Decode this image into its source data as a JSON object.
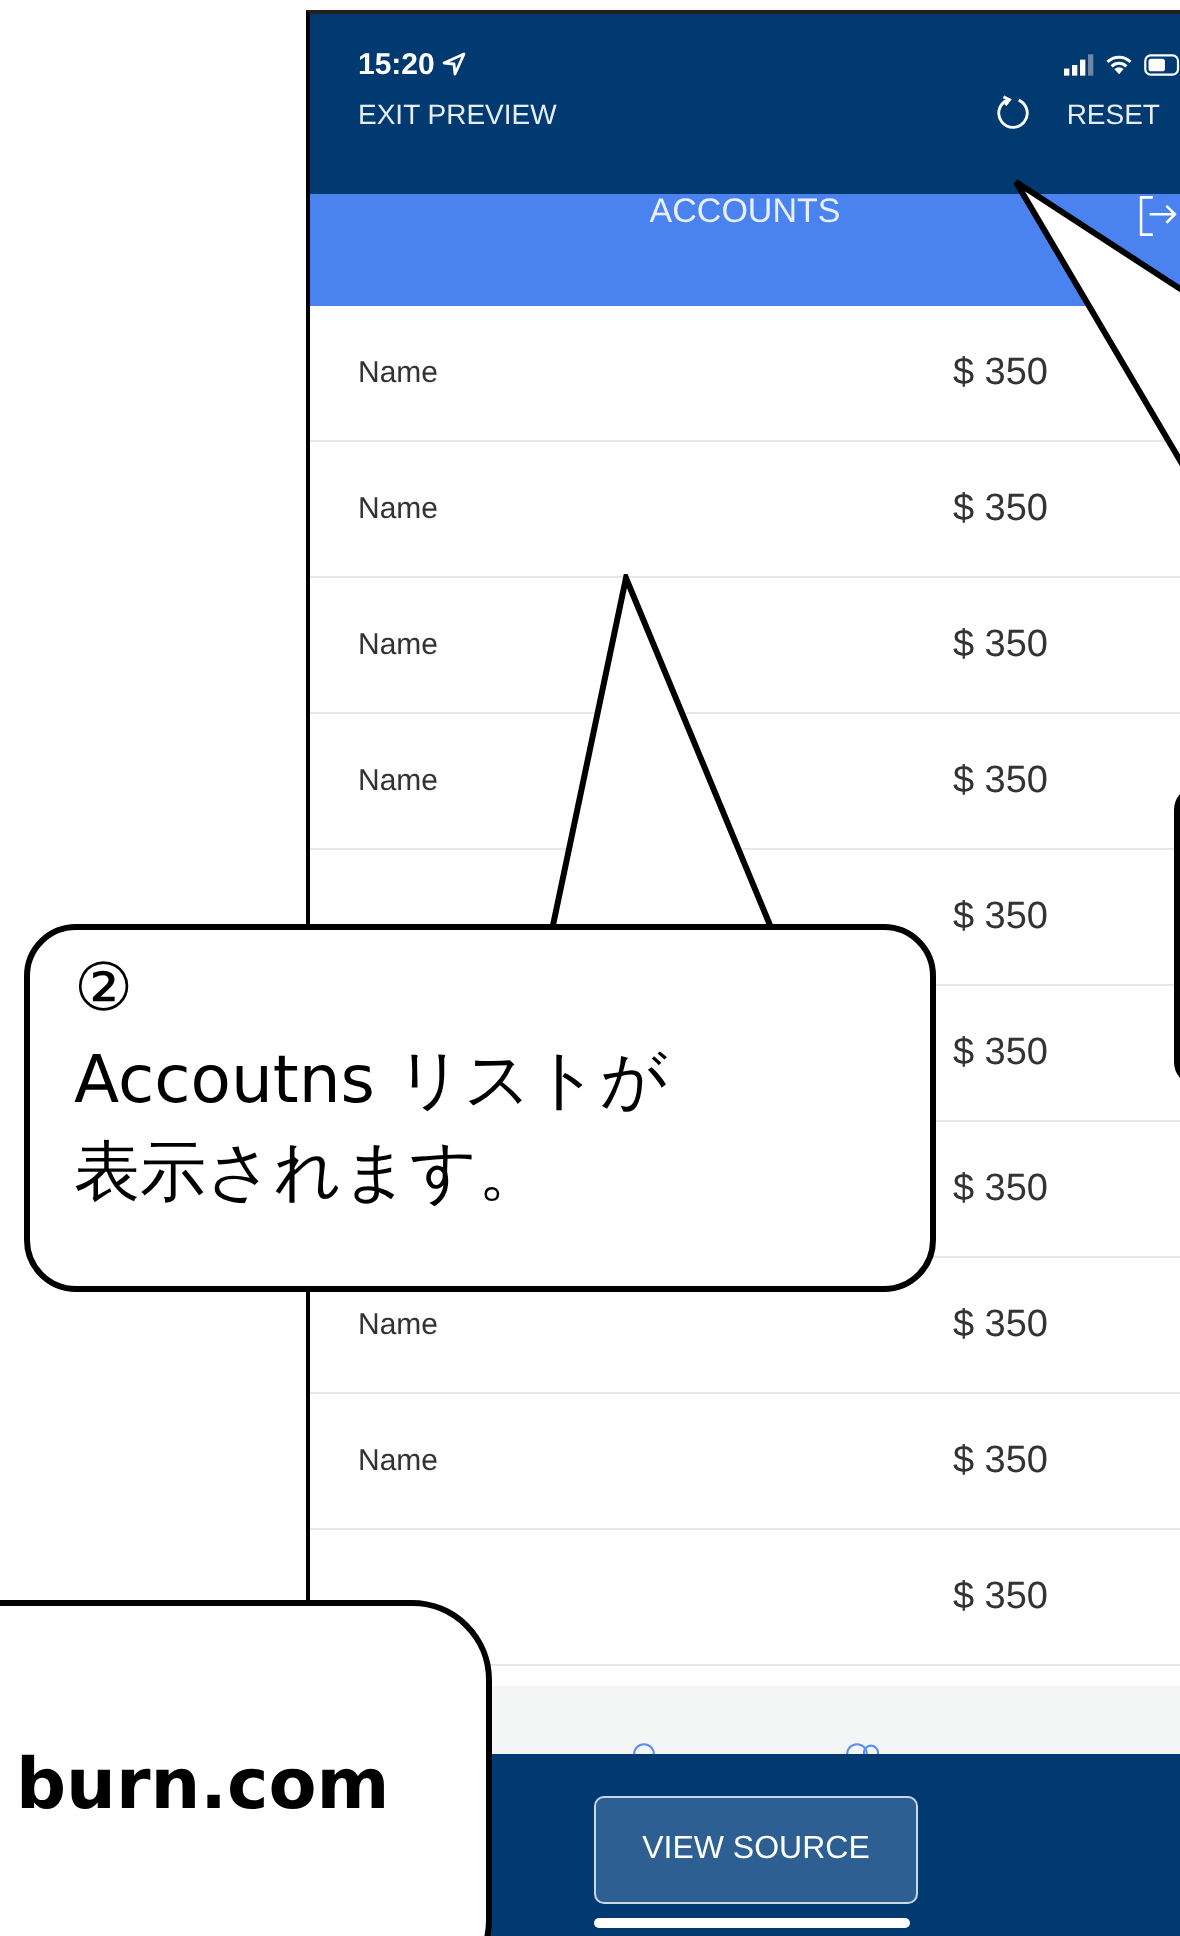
{
  "status_bar": {
    "time": "15:20"
  },
  "preview_bar": {
    "exit": "EXIT PREVIEW",
    "reset": "RESET"
  },
  "nav_bar": {
    "title": "ACCOUNTS"
  },
  "rows": [
    {
      "name": "Name",
      "amount": "$ 350"
    },
    {
      "name": "Name",
      "amount": "$ 350"
    },
    {
      "name": "Name",
      "amount": "$ 350"
    },
    {
      "name": "Name",
      "amount": "$ 350"
    },
    {
      "amount": "$ 350"
    },
    {
      "amount": "$ 350"
    },
    {
      "amount": "$ 350"
    },
    {
      "name": "Name",
      "amount": "$ 350"
    },
    {
      "name": "Name",
      "amount": "$ 350"
    },
    {
      "amount": "$ 350"
    }
  ],
  "bottom_bar": {
    "button": "VIEW SOURCE"
  },
  "callouts": [
    {
      "kind": "list",
      "lines": [
        "②",
        "Accoutns リストが",
        "表示されます。"
      ]
    },
    {
      "kind": "corner",
      "lines": [
        "burn.com"
      ]
    },
    {
      "kind": "edge"
    }
  ]
}
